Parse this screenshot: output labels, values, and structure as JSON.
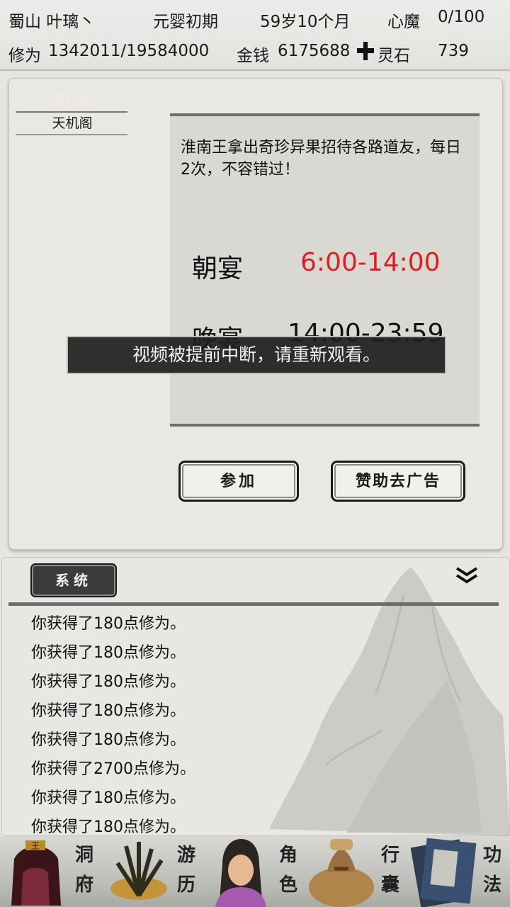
{
  "header": {
    "location_name": "蜀山 叶璃丶",
    "realm": "元婴初期",
    "age": "59岁10个月",
    "heart_demon_label": "心魔",
    "heart_demon_value": "0/100",
    "cultivation_label": "修为",
    "cultivation_value": "1342011/19584000",
    "money_label": "金钱",
    "money_value": "6175688",
    "spirit_stone_label": "灵石",
    "spirit_stone_value": "739"
  },
  "event": {
    "tab_active": "奇珍宴",
    "tab_other": "天机阁",
    "description": "淮南王拿出奇珍异果招待各路道友，每日2次，不容错过！",
    "morning_label": "朝宴",
    "morning_time": "6:00-14:00",
    "evening_label": "晚宴",
    "evening_time": "14:00-23:59",
    "join_button": "参加",
    "remove_ads_button": "赞助去广告",
    "accent_color": "#e11d1d"
  },
  "toast": {
    "message": "视频被提前中断，请重新观看。"
  },
  "log": {
    "tab_label": "系统",
    "collapse_icon": "double-chevron-down-icon",
    "lines": [
      "你获得了180点修为。",
      "你获得了180点修为。",
      "你获得了180点修为。",
      "你获得了180点修为。",
      "你获得了180点修为。",
      "你获得了2700点修为。",
      "你获得了180点修为。",
      "你获得了180点修为。"
    ]
  },
  "nav": {
    "items": [
      {
        "label_top": "洞",
        "label_bottom": "府",
        "icon": "cave-mansion-icon"
      },
      {
        "label_top": "游",
        "label_bottom": "历",
        "icon": "travel-icon"
      },
      {
        "label_top": "角",
        "label_bottom": "色",
        "icon": "character-icon"
      },
      {
        "label_top": "行",
        "label_bottom": "囊",
        "icon": "bag-icon"
      },
      {
        "label_top": "功",
        "label_bottom": "法",
        "icon": "scripture-icon"
      }
    ]
  }
}
